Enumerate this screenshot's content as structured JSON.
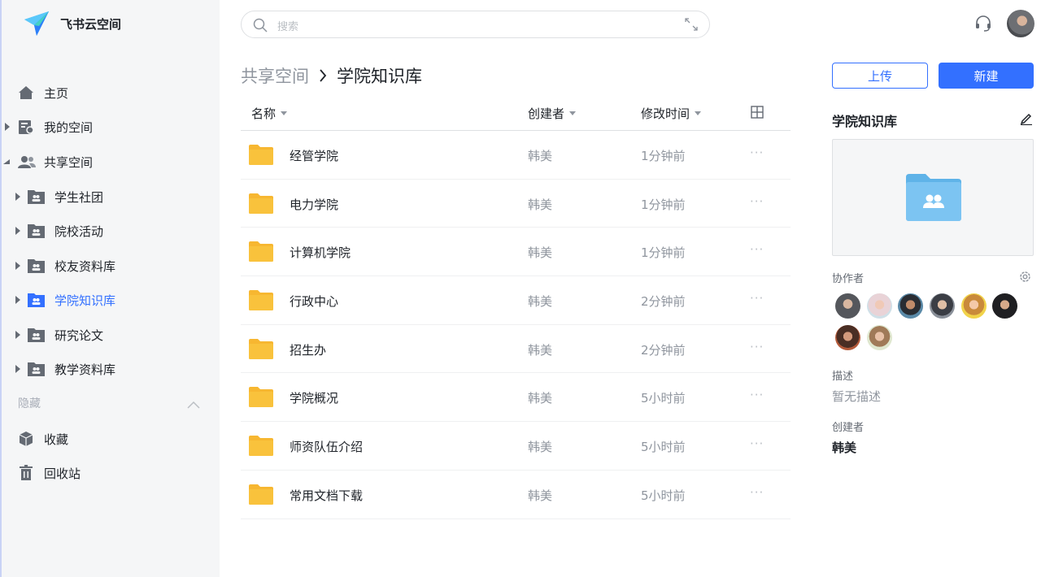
{
  "app": {
    "name": "飞书云空间"
  },
  "search": {
    "placeholder": "搜索"
  },
  "sidebar": {
    "items": [
      {
        "label": "主页",
        "icon": "home-icon"
      },
      {
        "label": "我的空间",
        "icon": "my-space-icon"
      },
      {
        "label": "共享空间",
        "icon": "shared-space-icon"
      }
    ],
    "shared_children": [
      {
        "label": "学生社团"
      },
      {
        "label": "院校活动"
      },
      {
        "label": "校友资料库"
      },
      {
        "label": "学院知识库",
        "active": true
      },
      {
        "label": "研究论文"
      },
      {
        "label": "教学资料库"
      }
    ],
    "hidden_section": "隐藏",
    "bottom_items": [
      {
        "label": "收藏",
        "icon": "favorites-icon"
      },
      {
        "label": "回收站",
        "icon": "trash-icon"
      }
    ]
  },
  "breadcrumb": {
    "parent": "共享空间",
    "current": "学院知识库"
  },
  "table": {
    "headers": {
      "name": "名称",
      "creator": "创建者",
      "modified": "修改时间"
    },
    "rows": [
      {
        "name": "经管学院",
        "creator": "韩美",
        "time": "1分钟前"
      },
      {
        "name": "电力学院",
        "creator": "韩美",
        "time": "1分钟前"
      },
      {
        "name": "计算机学院",
        "creator": "韩美",
        "time": "1分钟前"
      },
      {
        "name": "行政中心",
        "creator": "韩美",
        "time": "2分钟前"
      },
      {
        "name": "招生办",
        "creator": "韩美",
        "time": "2分钟前"
      },
      {
        "name": "学院概况",
        "creator": "韩美",
        "time": "5小时前"
      },
      {
        "name": "师资队伍介绍",
        "creator": "韩美",
        "time": "5小时前"
      },
      {
        "name": "常用文档下载",
        "creator": "韩美",
        "time": "5小时前"
      }
    ],
    "more": "···"
  },
  "panel": {
    "upload": "上传",
    "new": "新建",
    "title": "学院知识库",
    "collaborators_label": "协作者",
    "description_label": "描述",
    "description_value": "暂无描述",
    "creator_label": "创建者",
    "creator_value": "韩美"
  },
  "colors": {
    "accent": "#3370ff",
    "folder": "#f7b731",
    "shared_folder": "#7cc4f2"
  }
}
